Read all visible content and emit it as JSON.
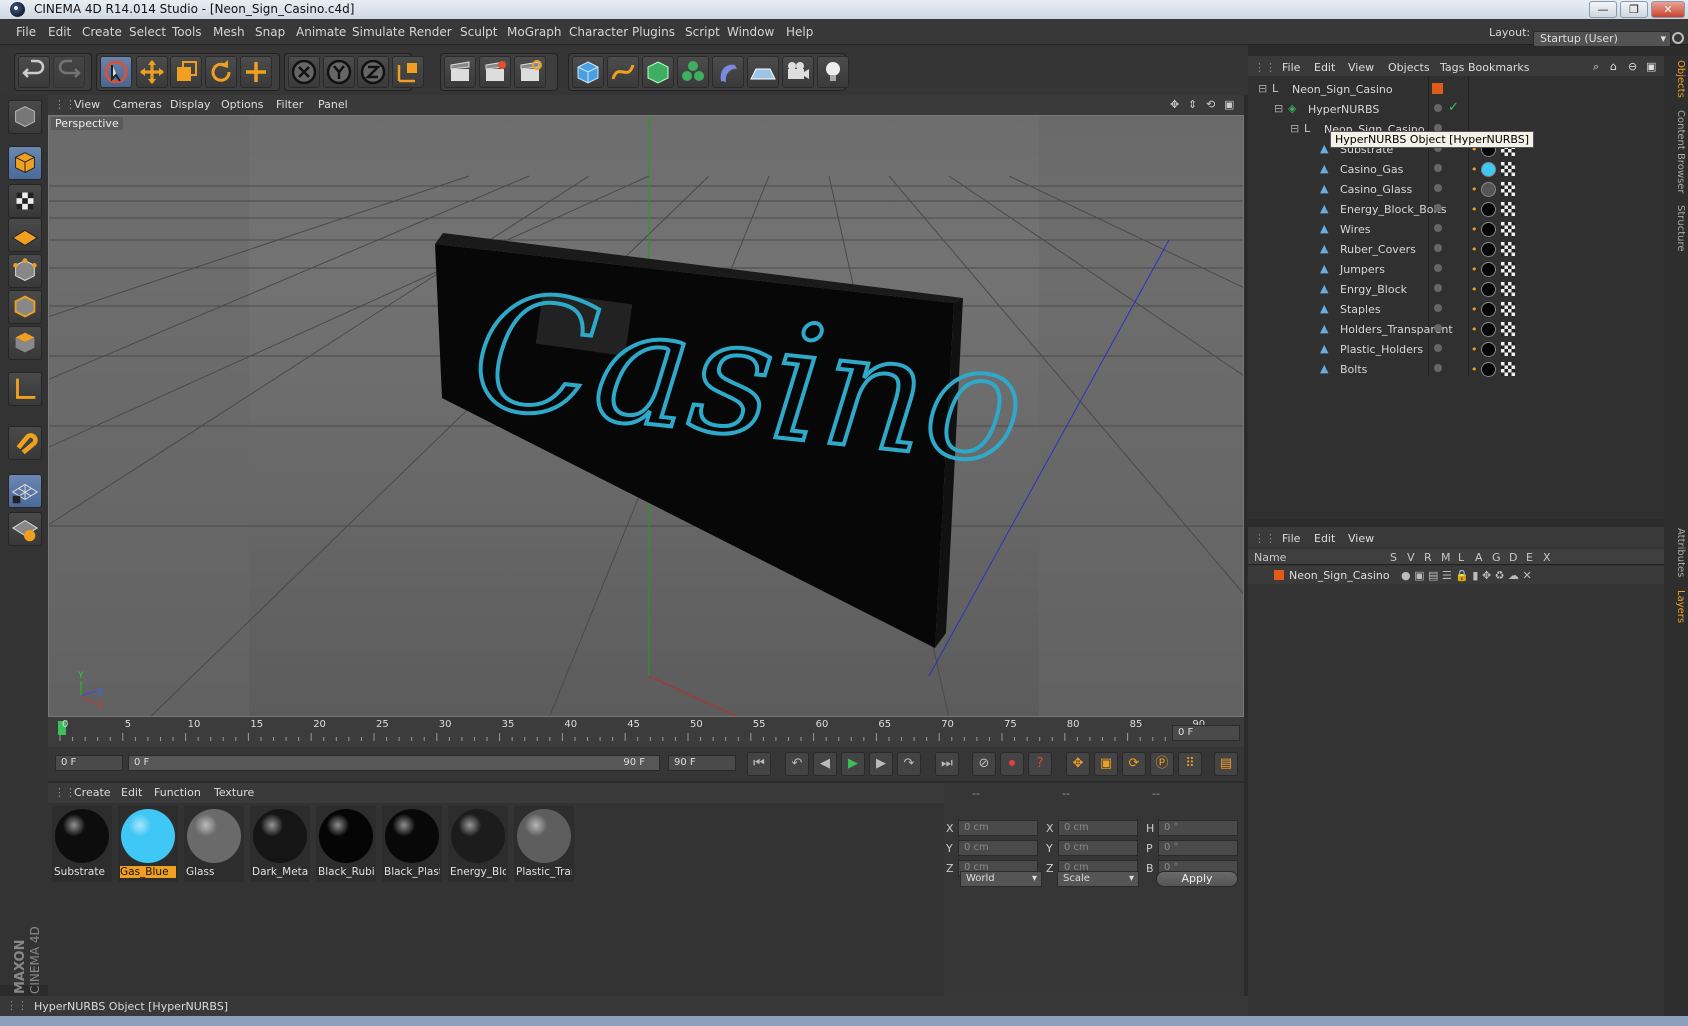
{
  "window": {
    "title": "CINEMA 4D R14.014 Studio - [Neon_Sign_Casino.c4d]",
    "btn_min": "—",
    "btn_max": "❐",
    "btn_close": "✕"
  },
  "menubar": {
    "items": [
      "File",
      "Edit",
      "Create",
      "Select",
      "Tools",
      "Mesh",
      "Snap",
      "Animate",
      "Simulate",
      "Render",
      "Sculpt",
      "MoGraph",
      "Character",
      "Plugins",
      "Script",
      "Window",
      "Help"
    ],
    "layout_label": "Layout:",
    "layout_value": "Startup (User)"
  },
  "viewport": {
    "menu": [
      "View",
      "Cameras",
      "Display",
      "Options",
      "Filter",
      "Panel"
    ],
    "label": "Perspective",
    "sign_text": "Casino",
    "axis_y": "Y",
    "axis_x": "X",
    "axis_z": "Z"
  },
  "timeline": {
    "ticks": [
      "0",
      "5",
      "10",
      "15",
      "20",
      "25",
      "30",
      "35",
      "40",
      "45",
      "50",
      "55",
      "60",
      "65",
      "70",
      "75",
      "80",
      "85",
      "90"
    ],
    "current_frame": "0 F"
  },
  "playback": {
    "start": "0 F",
    "range_start": "0 F",
    "range_end": "90 F",
    "end": "90 F"
  },
  "materials": {
    "menu": [
      "Create",
      "Edit",
      "Function",
      "Texture"
    ],
    "items": [
      {
        "name": "Substrate",
        "color": "#0d0d0d"
      },
      {
        "name": "Gas_Blue",
        "color": "#3fc8f5",
        "selected": true
      },
      {
        "name": "Glass",
        "color": "#6a6a6a"
      },
      {
        "name": "Dark_Meta",
        "color": "#151515"
      },
      {
        "name": "Black_Rubi",
        "color": "#050505"
      },
      {
        "name": "Black_Plast",
        "color": "#080808"
      },
      {
        "name": "Energy_Blo",
        "color": "#1c1c1c"
      },
      {
        "name": "Plastic_Tran",
        "color": "#5e5e5e"
      }
    ]
  },
  "coords": {
    "head1": "--",
    "head2": "--",
    "head3": "--",
    "rows": [
      {
        "a": "X",
        "av": "0 cm",
        "b": "X",
        "bv": "0 cm",
        "c": "H",
        "cv": "0 °"
      },
      {
        "a": "Y",
        "av": "0 cm",
        "b": "Y",
        "bv": "0 cm",
        "c": "P",
        "cv": "0 °"
      },
      {
        "a": "Z",
        "av": "0 cm",
        "b": "Z",
        "bv": "0 cm",
        "c": "B",
        "cv": "0 °"
      }
    ],
    "space": "World",
    "mode": "Scale",
    "apply": "Apply"
  },
  "objects": {
    "menu": [
      "File",
      "Edit",
      "View",
      "Objects",
      "Tags",
      "Bookmarks"
    ],
    "tree": [
      {
        "name": "Neon_Sign_Casino",
        "level": 0
      },
      {
        "name": "HyperNURBS",
        "level": 1
      },
      {
        "name": "Neon_Sign_Casino",
        "level": 2
      },
      {
        "name": "Substrate",
        "level": 3
      },
      {
        "name": "Casino_Gas",
        "level": 3
      },
      {
        "name": "Casino_Glass",
        "level": 3
      },
      {
        "name": "Energy_Block_Bolts",
        "level": 3
      },
      {
        "name": "Wires",
        "level": 3
      },
      {
        "name": "Ruber_Covers",
        "level": 3
      },
      {
        "name": "Jumpers",
        "level": 3
      },
      {
        "name": "Enrgy_Block",
        "level": 3
      },
      {
        "name": "Staples",
        "level": 3
      },
      {
        "name": "Holders_Transparent",
        "level": 3
      },
      {
        "name": "Plastic_Holders",
        "level": 3
      },
      {
        "name": "Bolts",
        "level": 3
      }
    ],
    "tooltip": "HyperNURBS Object [HyperNURBS]"
  },
  "layers": {
    "menu": [
      "File",
      "Edit",
      "View"
    ],
    "col_name": "Name",
    "cols": [
      "S",
      "V",
      "R",
      "M",
      "L",
      "A",
      "G",
      "D",
      "E",
      "X"
    ],
    "layer_name": "Neon_Sign_Casino"
  },
  "side_tabs": [
    "Objects",
    "Content Browser",
    "Structure",
    "Attributes",
    "Layers"
  ],
  "status": {
    "text": "HyperNURBS Object [HyperNURBS]"
  },
  "brand": {
    "line1": "MAXON",
    "line2": "CINEMA 4D"
  }
}
